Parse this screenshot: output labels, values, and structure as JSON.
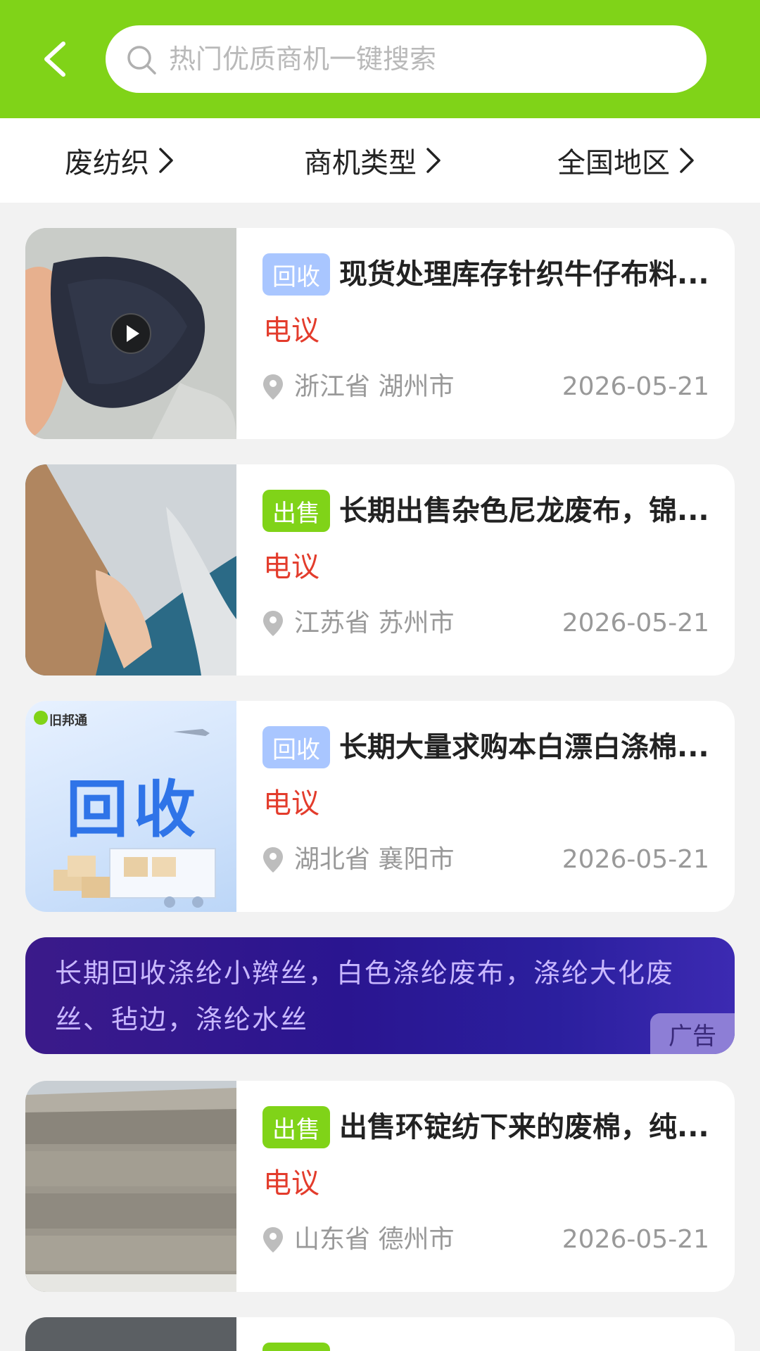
{
  "header": {
    "back_icon": "chevron-left-icon",
    "search_placeholder": "热门优质商机一键搜索",
    "search_icon": "search-icon",
    "bg_color": "#80d318"
  },
  "filters": [
    {
      "label": "废纺织",
      "icon": "chevron-right-icon"
    },
    {
      "label": "商机类型",
      "icon": "chevron-right-icon"
    },
    {
      "label": "全国地区",
      "icon": "chevron-right-icon"
    }
  ],
  "listings": [
    {
      "tag": "回收",
      "title": "现货处理库存针织牛仔布料...",
      "price": "电议",
      "location": "浙江省 湖州市",
      "date": "2026-05-21",
      "has_video": true
    },
    {
      "tag": "出售",
      "title": "长期出售杂色尼龙废布，锦...",
      "price": "电议",
      "location": "江苏省 苏州市",
      "date": "2026-05-21",
      "has_video": false
    },
    {
      "tag": "回收",
      "title": "长期大量求购本白漂白涤棉...",
      "price": "电议",
      "location": "湖北省 襄阳市",
      "date": "2026-05-21",
      "has_video": false,
      "thumb_text": "回收",
      "thumb_logo": "旧邦通"
    },
    {
      "tag": "出售",
      "title": "出售环锭纺下来的废棉，纯...",
      "price": "电议",
      "location": "山东省 德州市",
      "date": "2026-05-21",
      "has_video": false
    }
  ],
  "ad": {
    "text": "长期回收涤纶小辫丝，白色涤纶废布，涤纶大化废丝、毡边，涤纶水丝",
    "badge": "广告"
  },
  "colors": {
    "accent": "#80d318",
    "price": "#e33c2c",
    "tag_recycle": "#a9c6ff",
    "tag_sell": "#80d318"
  }
}
